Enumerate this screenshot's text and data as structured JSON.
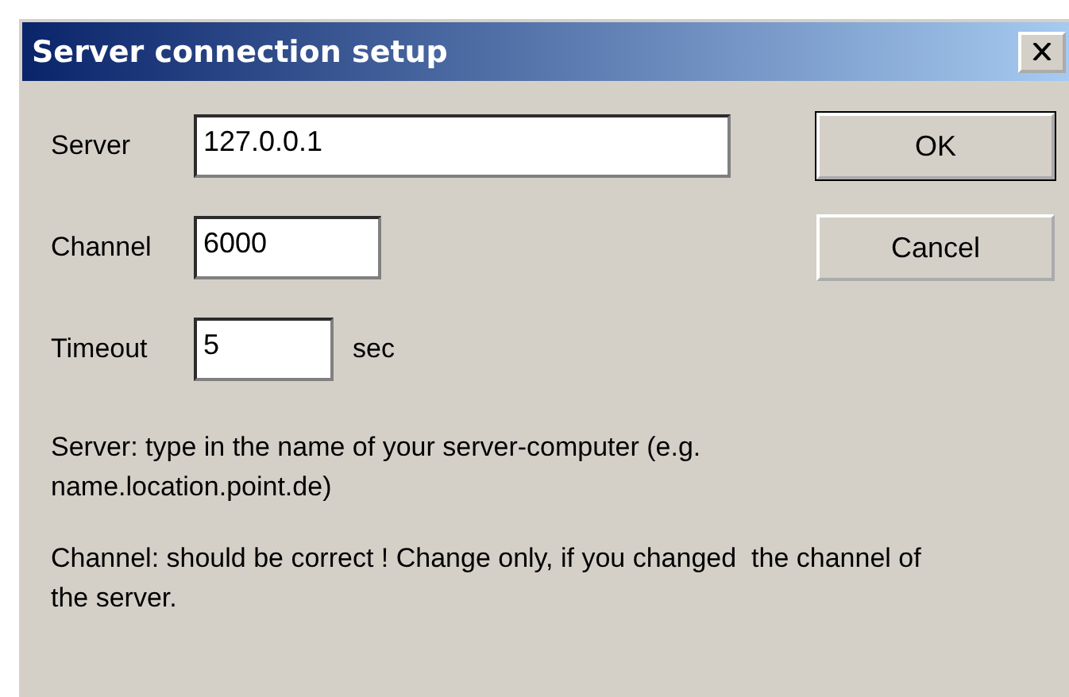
{
  "window": {
    "title": "Server connection setup"
  },
  "fields": [
    {
      "label": "Server",
      "value": "127.0.0.1"
    },
    {
      "label": "Channel",
      "value": "6000"
    },
    {
      "label": "Timeout",
      "value": "5",
      "unit": "sec"
    }
  ],
  "buttons": [
    {
      "label": "OK",
      "default": true
    },
    {
      "label": "Cancel",
      "default": false
    }
  ],
  "help": [
    "Server: type in the name of your server-computer (e.g. name.location.point.de)",
    "Channel: should be correct ! Change only, if you changed  the channel of the server."
  ]
}
